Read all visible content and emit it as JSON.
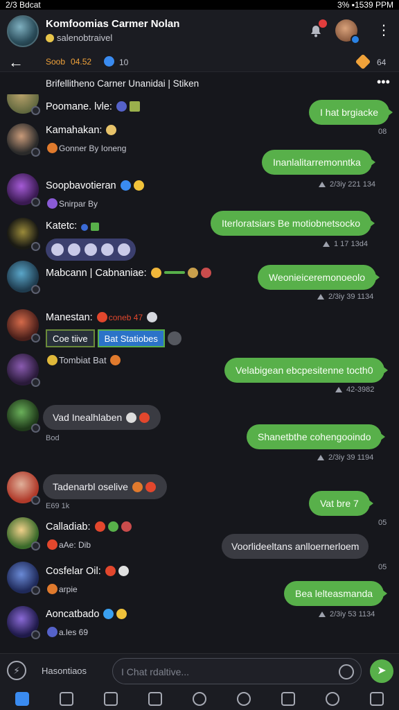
{
  "status_bar": {
    "left": "2/3 Bdcat",
    "right": "3% ▪1539 PPM"
  },
  "header": {
    "title": "Komfoomias Carmer Nolan",
    "subtitle": "salenobtraivel"
  },
  "subheader": {
    "stat_label": "Soob",
    "stat_value": "04.52",
    "verified_count": "10",
    "tag_count": "64"
  },
  "pinned": {
    "text": "Brifellitheno Carner Unanidai |  Stiken"
  },
  "messages": [
    {
      "name": "Poomane. lvle:"
    },
    {
      "name": "Kamahakan:",
      "meta": "Gonner By  Ioneng"
    },
    {
      "name": "Soopbavotieran",
      "meta": "Snirpar By"
    },
    {
      "name": "Katetc:"
    },
    {
      "name": "Mabcann | Cabnaniae:"
    },
    {
      "name": "Manestan:",
      "extra": "coneb 47",
      "chip1": "Coe tiive",
      "chip2": "Bat Statiobes"
    },
    {
      "name": "",
      "meta": "Tombiat  Bat"
    },
    {
      "name": "",
      "bubble": "Vad Inealhlaben",
      "meta": "Bod"
    },
    {
      "name": "",
      "bubble": "Tadenarbl oselive",
      "meta": "E69 1k"
    },
    {
      "name": "Calladiab:",
      "meta": "aAe: Dib"
    },
    {
      "name": "Cosfelar Oil:",
      "meta": "arpie"
    },
    {
      "name": "Aoncatbado",
      "meta": "a.les  69"
    }
  ],
  "outgoing": [
    {
      "text": "I hat brgiacke",
      "time": "08"
    },
    {
      "text": "Inanlalitarremonntka",
      "time": "2/3iy  221 134"
    },
    {
      "text": "Iterloratsiars Be motiobnetsocko",
      "time": "1  17  13d4"
    },
    {
      "text": "Weonieiceremonoeolo",
      "time": "2/3iy  39 1134"
    },
    {
      "text": "Velabigean ebcpesitenne tocth0",
      "time": "42-3982"
    },
    {
      "text": "Shanetbthe cohengooindo",
      "time": "2/3iy 39 1194"
    },
    {
      "text": "Vat bre  7",
      "time": "05"
    },
    {
      "text": "Bea lelteasmanda",
      "time": "2/3iy  53 1134"
    }
  ],
  "incoming_gray": [
    {
      "text": "Voorlideeltans  anlloernerloem",
      "time": "05"
    }
  ],
  "compose": {
    "label": "Hasontiaos",
    "placeholder": "I Chat rdaltive..."
  },
  "colors": {
    "accent_green": "#58b04a",
    "accent_blue": "#3a8bf0",
    "background": "#16171c"
  }
}
